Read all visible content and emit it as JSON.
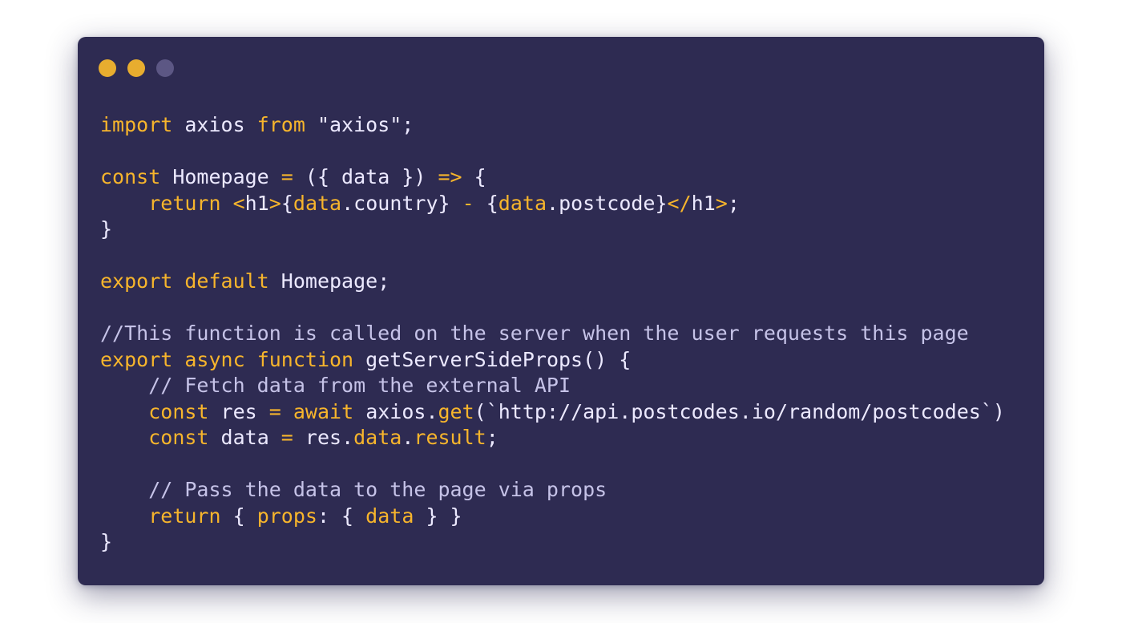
{
  "window": {
    "background": "#2e2b52",
    "controls": [
      {
        "name": "close-dot",
        "color": "#e8ad2f"
      },
      {
        "name": "minimize-dot",
        "color": "#e8ad2f"
      },
      {
        "name": "maximize-dot",
        "color": "#5c5784"
      }
    ]
  },
  "colors": {
    "keyword": "#f7b52c",
    "default": "#ece9ff",
    "comment": "#c6c3e8"
  },
  "code": {
    "language": "javascript",
    "lines": [
      [
        {
          "t": "keyword",
          "v": "import"
        },
        {
          "t": "default",
          "v": " axios "
        },
        {
          "t": "keyword",
          "v": "from"
        },
        {
          "t": "default",
          "v": " \"axios\";"
        }
      ],
      [],
      [
        {
          "t": "keyword",
          "v": "const"
        },
        {
          "t": "default",
          "v": " Homepage "
        },
        {
          "t": "op",
          "v": "="
        },
        {
          "t": "default",
          "v": " ({ data }) "
        },
        {
          "t": "op",
          "v": "=>"
        },
        {
          "t": "default",
          "v": " {"
        }
      ],
      [
        {
          "t": "default",
          "v": "    "
        },
        {
          "t": "keyword",
          "v": "return"
        },
        {
          "t": "default",
          "v": " "
        },
        {
          "t": "op",
          "v": "<"
        },
        {
          "t": "default",
          "v": "h1"
        },
        {
          "t": "op",
          "v": ">"
        },
        {
          "t": "default",
          "v": "{"
        },
        {
          "t": "keyword",
          "v": "data"
        },
        {
          "t": "default",
          "v": ".country} "
        },
        {
          "t": "op",
          "v": "-"
        },
        {
          "t": "default",
          "v": " {"
        },
        {
          "t": "keyword",
          "v": "data"
        },
        {
          "t": "default",
          "v": ".postcode}"
        },
        {
          "t": "op",
          "v": "</"
        },
        {
          "t": "default",
          "v": "h1"
        },
        {
          "t": "op",
          "v": ">"
        },
        {
          "t": "default",
          "v": ";"
        }
      ],
      [
        {
          "t": "default",
          "v": "}"
        }
      ],
      [],
      [
        {
          "t": "keyword",
          "v": "export"
        },
        {
          "t": "default",
          "v": " "
        },
        {
          "t": "keyword",
          "v": "default"
        },
        {
          "t": "default",
          "v": " Homepage;"
        }
      ],
      [],
      [
        {
          "t": "comment",
          "v": "//This function is called on the server when the user requests this page"
        }
      ],
      [
        {
          "t": "keyword",
          "v": "export"
        },
        {
          "t": "default",
          "v": " "
        },
        {
          "t": "keyword",
          "v": "async"
        },
        {
          "t": "default",
          "v": " "
        },
        {
          "t": "keyword",
          "v": "function"
        },
        {
          "t": "default",
          "v": " getServerSideProps() {"
        }
      ],
      [
        {
          "t": "default",
          "v": "    "
        },
        {
          "t": "comment",
          "v": "// Fetch data from the external API"
        }
      ],
      [
        {
          "t": "default",
          "v": "    "
        },
        {
          "t": "keyword",
          "v": "const"
        },
        {
          "t": "default",
          "v": " res "
        },
        {
          "t": "op",
          "v": "="
        },
        {
          "t": "default",
          "v": " "
        },
        {
          "t": "keyword",
          "v": "await"
        },
        {
          "t": "default",
          "v": " axios."
        },
        {
          "t": "keyword",
          "v": "get"
        },
        {
          "t": "default",
          "v": "(`http://api.postcodes.io/random/postcodes`)"
        }
      ],
      [
        {
          "t": "default",
          "v": "    "
        },
        {
          "t": "keyword",
          "v": "const"
        },
        {
          "t": "default",
          "v": " data "
        },
        {
          "t": "op",
          "v": "="
        },
        {
          "t": "default",
          "v": " res."
        },
        {
          "t": "keyword",
          "v": "data"
        },
        {
          "t": "default",
          "v": "."
        },
        {
          "t": "keyword",
          "v": "result"
        },
        {
          "t": "default",
          "v": ";"
        }
      ],
      [],
      [
        {
          "t": "default",
          "v": "    "
        },
        {
          "t": "comment",
          "v": "// Pass the data to the page via props"
        }
      ],
      [
        {
          "t": "default",
          "v": "    "
        },
        {
          "t": "keyword",
          "v": "return"
        },
        {
          "t": "default",
          "v": " { "
        },
        {
          "t": "keyword",
          "v": "props"
        },
        {
          "t": "default",
          "v": ": { "
        },
        {
          "t": "keyword",
          "v": "data"
        },
        {
          "t": "default",
          "v": " } }"
        }
      ],
      [
        {
          "t": "default",
          "v": "}"
        }
      ]
    ]
  }
}
